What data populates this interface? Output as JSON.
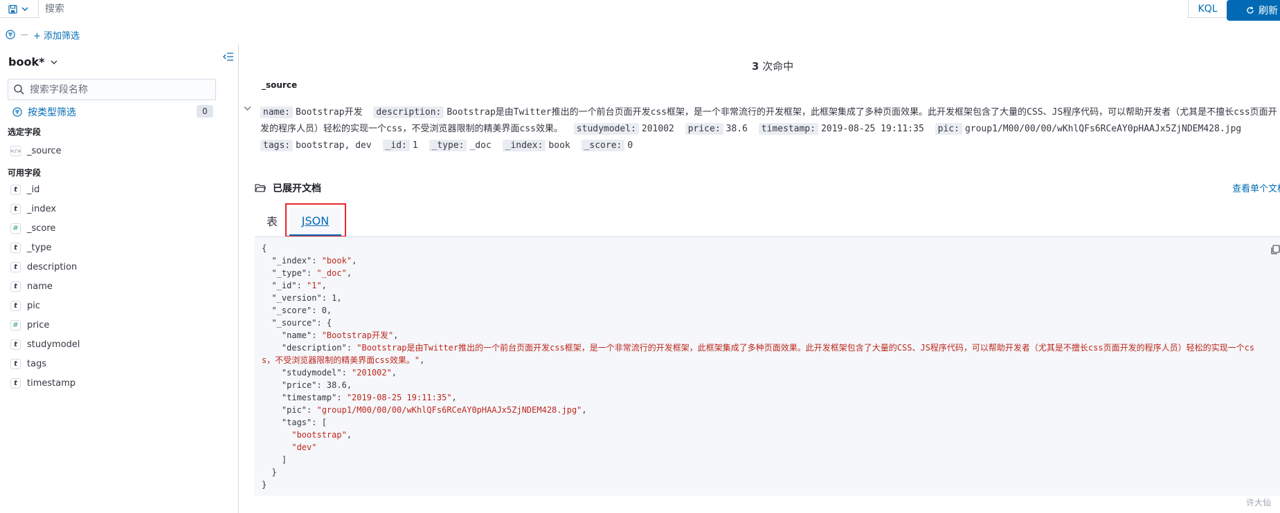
{
  "topbar": {
    "search_placeholder": "搜索",
    "kql_label": "KQL",
    "refresh_label": "刷新"
  },
  "filters": {
    "add_filter_label": "+ 添加筛选"
  },
  "sidebar": {
    "index_name": "book*",
    "field_search_placeholder": "搜索字段名称",
    "type_filter_label": "按类型筛选",
    "type_filter_count": "0",
    "selected_title": "选定字段",
    "selected_fields": [
      {
        "name": "_source",
        "type": "source"
      }
    ],
    "available_title": "可用字段",
    "available_fields": [
      {
        "name": "_id",
        "type": "t"
      },
      {
        "name": "_index",
        "type": "t"
      },
      {
        "name": "_score",
        "type": "#"
      },
      {
        "name": "_type",
        "type": "t"
      },
      {
        "name": "description",
        "type": "t"
      },
      {
        "name": "name",
        "type": "t"
      },
      {
        "name": "pic",
        "type": "t"
      },
      {
        "name": "price",
        "type": "#"
      },
      {
        "name": "studymodel",
        "type": "t"
      },
      {
        "name": "tags",
        "type": "t"
      },
      {
        "name": "timestamp",
        "type": "t"
      }
    ]
  },
  "main": {
    "hits_count": "3",
    "hits_label": "次命中",
    "source_header": "_source",
    "summary": [
      {
        "key": "name:",
        "value": "Bootstrap开发"
      },
      {
        "key": "description:",
        "value": "Bootstrap是由Twitter推出的一个前台页面开发css框架，是一个非常流行的开发框架，此框架集成了多种页面效果。此开发框架包含了大量的CSS、JS程序代码，可以帮助开发者（尤其是不擅长css页面开发的程序人员）轻松的实现一个css，不受浏览器限制的精美界面css效果。"
      },
      {
        "key": "studymodel:",
        "value": "201002"
      },
      {
        "key": "price:",
        "value": "38.6"
      },
      {
        "key": "timestamp:",
        "value": "2019-08-25 19:11:35"
      },
      {
        "key": "pic:",
        "value": "group1/M00/00/00/wKhlQFs6RCeAY0pHAAJx5ZjNDEM428.jpg"
      },
      {
        "key": "tags:",
        "value": "bootstrap, dev"
      },
      {
        "key": "_id:",
        "value": "1"
      },
      {
        "key": "_type:",
        "value": "_doc"
      },
      {
        "key": "_index:",
        "value": "book"
      },
      {
        "key": "_score:",
        "value": "0"
      }
    ],
    "expanded_title": "已展开文档",
    "view_single_label": "查看单个文档",
    "tab_table_label": "表",
    "tab_json_label": "JSON",
    "json_lines": [
      [
        [
          "p",
          "{"
        ]
      ],
      [
        [
          "p",
          "  \"_index\": "
        ],
        [
          "s",
          "\"book\""
        ],
        [
          "p",
          ","
        ]
      ],
      [
        [
          "p",
          "  \"_type\": "
        ],
        [
          "s",
          "\"_doc\""
        ],
        [
          "p",
          ","
        ]
      ],
      [
        [
          "p",
          "  \"_id\": "
        ],
        [
          "s",
          "\"1\""
        ],
        [
          "p",
          ","
        ]
      ],
      [
        [
          "p",
          "  \"_version\": 1,"
        ]
      ],
      [
        [
          "p",
          "  \"_score\": 0,"
        ]
      ],
      [
        [
          "p",
          "  \"_source\": {"
        ]
      ],
      [
        [
          "p",
          "    \"name\": "
        ],
        [
          "s",
          "\"Bootstrap开发\""
        ],
        [
          "p",
          ","
        ]
      ],
      [
        [
          "p",
          "    \"description\": "
        ],
        [
          "s",
          "\"Bootstrap是由Twitter推出的一个前台页面开发css框架，是一个非常流行的开发框架，此框架集成了多种页面效果。此开发框架包含了大量的CSS、JS程序代码，可以帮助开发者（尤其是不擅长css页面开发的程序人员）轻松的实现一个cs"
        ]
      ],
      [
        [
          "s",
          "s，不受浏览器限制的精美界面css效果。\""
        ],
        [
          "p",
          ","
        ]
      ],
      [
        [
          "p",
          "    \"studymodel\": "
        ],
        [
          "s",
          "\"201002\""
        ],
        [
          "p",
          ","
        ]
      ],
      [
        [
          "p",
          "    \"price\": 38.6,"
        ]
      ],
      [
        [
          "p",
          "    \"timestamp\": "
        ],
        [
          "s",
          "\"2019-08-25 19:11:35\""
        ],
        [
          "p",
          ","
        ]
      ],
      [
        [
          "p",
          "    \"pic\": "
        ],
        [
          "s",
          "\"group1/M00/00/00/wKhlQFs6RCeAY0pHAAJx5ZjNDEM428.jpg\""
        ],
        [
          "p",
          ","
        ]
      ],
      [
        [
          "p",
          "    \"tags\": ["
        ]
      ],
      [
        [
          "p",
          "      "
        ],
        [
          "s",
          "\"bootstrap\""
        ],
        [
          "p",
          ","
        ]
      ],
      [
        [
          "p",
          "      "
        ],
        [
          "s",
          "\"dev\""
        ]
      ],
      [
        [
          "p",
          "    ]"
        ]
      ],
      [
        [
          "p",
          "  }"
        ]
      ],
      [
        [
          "p",
          "}"
        ]
      ]
    ]
  },
  "watermark": "许大仙",
  "colors": {
    "accent": "#006bb4",
    "highlight_border": "#e7262b",
    "json_string": "#bd271e"
  }
}
